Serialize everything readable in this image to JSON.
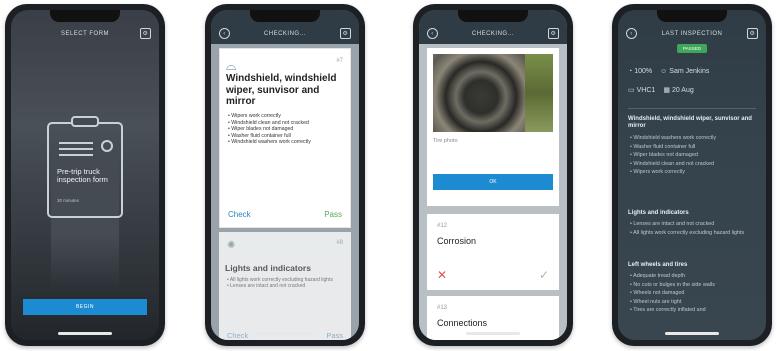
{
  "screen1": {
    "header_title": "SELECT FORM",
    "form_title": "Pre-trip truck inspection form",
    "form_subtitle": "30 minutes",
    "start_label": "BEGIN"
  },
  "screen2": {
    "header_title": "CHECKING...",
    "card_number": "#7",
    "card_title": "Windshield, windshield wiper, sunvisor and mirror",
    "checklist": [
      "Wipers work correctly",
      "Windshield clean and not cracked",
      "Wiper blades not damaged",
      "Washer fluid container full",
      "Windshield washers work correctly"
    ],
    "check_label": "Check",
    "pass_label": "Pass",
    "next_number": "#8",
    "next_title": "Lights and indicators",
    "next_checklist": [
      "All lights work correctly excluding hazard lights",
      "Lenses are intact and not cracked"
    ],
    "next_check_label": "Check",
    "next_pass_label": "Pass"
  },
  "screen3": {
    "header_title": "CHECKING...",
    "photo_caption": "Tire photo",
    "ok_label": "OK",
    "item1_number": "#12",
    "item1_title": "Corrosion",
    "item2_number": "#13",
    "item2_title": "Connections"
  },
  "screen4": {
    "header_title": "LAST INSPECTION",
    "status_badge": "PASSED",
    "meta": {
      "fuel": "100%",
      "driver": "Sam Jenkins",
      "vehicle": "VHC1",
      "date": "20 Aug"
    },
    "section1_title": "Windshield, windshield wiper, sunvisor and mirror",
    "section1_items": [
      "Windshield washers work correctly",
      "Washer fluid container full",
      "Wiper blades not damaged",
      "Windshield clean and not cracked",
      "Wipers work correctly"
    ],
    "section2_title": "Lights and indicators",
    "section2_items": [
      "Lenses are intact and not cracked",
      "All lights work correctly excluding hazard lights"
    ],
    "section3_title": "Left wheels and tires",
    "section3_items": [
      "Adequate tread depth",
      "No cuts or bulges in the side walls",
      "Wheels not damaged",
      "Wheel nuts are tight",
      "Tires are correctly inflated and"
    ]
  },
  "icons": {
    "back": "chevron-left-icon",
    "settings": "gear-icon"
  },
  "colors": {
    "accent": "#1d8bd2",
    "dark_header": "#2f3c45",
    "pass_green": "#5aa85a",
    "fail_red": "#e05555",
    "badge_green": "#3ea75a"
  }
}
